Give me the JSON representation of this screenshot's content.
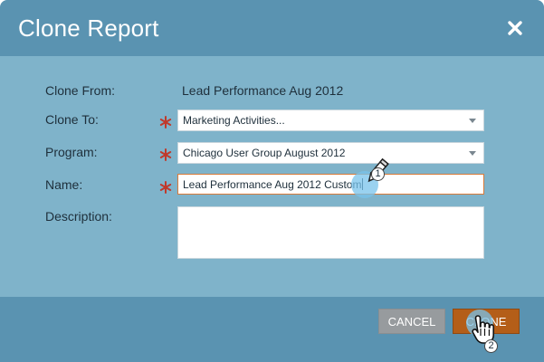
{
  "dialog": {
    "title": "Clone Report",
    "close_icon": "close-icon"
  },
  "form": {
    "clone_from": {
      "label": "Clone From:",
      "value": "Lead Performance Aug 2012"
    },
    "clone_to": {
      "label": "Clone To:",
      "value": "Marketing Activities...",
      "required": true
    },
    "program": {
      "label": "Program:",
      "value": "Chicago User Group August 2012",
      "required": true
    },
    "name": {
      "label": "Name:",
      "value": "Lead Performance Aug 2012 Custom",
      "required": true
    },
    "description": {
      "label": "Description:",
      "value": ""
    },
    "required_marker": "*"
  },
  "footer": {
    "cancel_label": "CANCEL",
    "clone_label": "CLONE"
  },
  "annotations": {
    "step1": "1",
    "step2": "2",
    "step1_icon": "pencil-cursor-icon",
    "step2_icon": "hand-pointer-icon"
  },
  "colors": {
    "titlebar": "#5a93b1",
    "body": "#7fb3ca",
    "clone_button": "#b45e18",
    "cancel_button": "#979b9e",
    "required_star": "#c0392b",
    "focus_border": "#d77a3a"
  }
}
